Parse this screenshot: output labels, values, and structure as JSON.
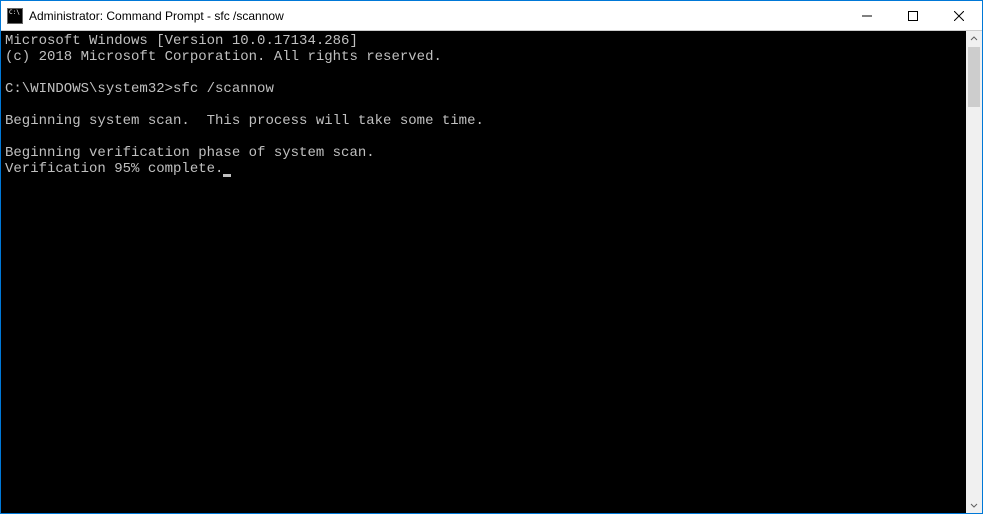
{
  "window": {
    "title": "Administrator: Command Prompt - sfc  /scannow"
  },
  "terminal": {
    "line1": "Microsoft Windows [Version 10.0.17134.286]",
    "line2": "(c) 2018 Microsoft Corporation. All rights reserved.",
    "blank1": "",
    "prompt_line": "C:\\WINDOWS\\system32>sfc /scannow",
    "blank2": "",
    "scan_start": "Beginning system scan.  This process will take some time.",
    "blank3": "",
    "verify_start": "Beginning verification phase of system scan.",
    "verify_progress": "Verification 95% complete."
  }
}
